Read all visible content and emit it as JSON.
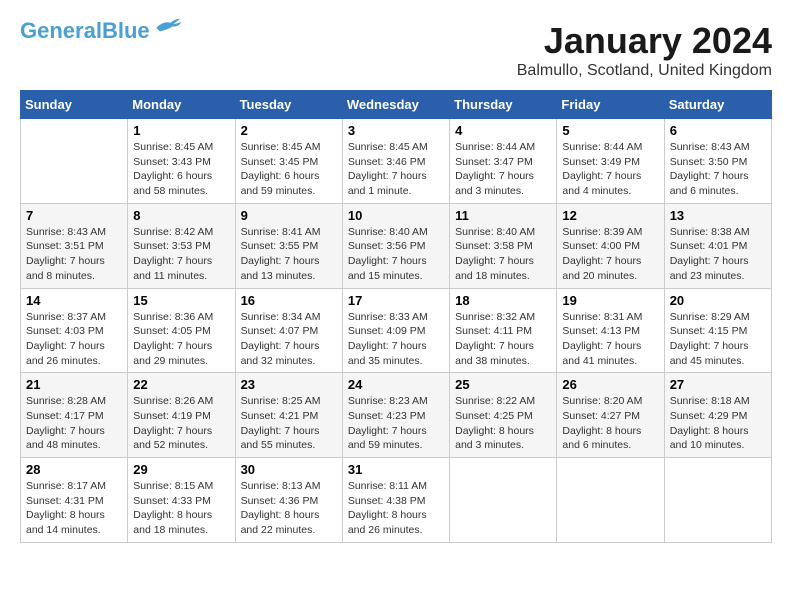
{
  "header": {
    "logo_line1": "General",
    "logo_line2": "Blue",
    "month_title": "January 2024",
    "subtitle": "Balmullo, Scotland, United Kingdom"
  },
  "days_of_week": [
    "Sunday",
    "Monday",
    "Tuesday",
    "Wednesday",
    "Thursday",
    "Friday",
    "Saturday"
  ],
  "weeks": [
    [
      {
        "day": "",
        "info": ""
      },
      {
        "day": "1",
        "info": "Sunrise: 8:45 AM\nSunset: 3:43 PM\nDaylight: 6 hours\nand 58 minutes."
      },
      {
        "day": "2",
        "info": "Sunrise: 8:45 AM\nSunset: 3:45 PM\nDaylight: 6 hours\nand 59 minutes."
      },
      {
        "day": "3",
        "info": "Sunrise: 8:45 AM\nSunset: 3:46 PM\nDaylight: 7 hours\nand 1 minute."
      },
      {
        "day": "4",
        "info": "Sunrise: 8:44 AM\nSunset: 3:47 PM\nDaylight: 7 hours\nand 3 minutes."
      },
      {
        "day": "5",
        "info": "Sunrise: 8:44 AM\nSunset: 3:49 PM\nDaylight: 7 hours\nand 4 minutes."
      },
      {
        "day": "6",
        "info": "Sunrise: 8:43 AM\nSunset: 3:50 PM\nDaylight: 7 hours\nand 6 minutes."
      }
    ],
    [
      {
        "day": "7",
        "info": "Sunrise: 8:43 AM\nSunset: 3:51 PM\nDaylight: 7 hours\nand 8 minutes."
      },
      {
        "day": "8",
        "info": "Sunrise: 8:42 AM\nSunset: 3:53 PM\nDaylight: 7 hours\nand 11 minutes."
      },
      {
        "day": "9",
        "info": "Sunrise: 8:41 AM\nSunset: 3:55 PM\nDaylight: 7 hours\nand 13 minutes."
      },
      {
        "day": "10",
        "info": "Sunrise: 8:40 AM\nSunset: 3:56 PM\nDaylight: 7 hours\nand 15 minutes."
      },
      {
        "day": "11",
        "info": "Sunrise: 8:40 AM\nSunset: 3:58 PM\nDaylight: 7 hours\nand 18 minutes."
      },
      {
        "day": "12",
        "info": "Sunrise: 8:39 AM\nSunset: 4:00 PM\nDaylight: 7 hours\nand 20 minutes."
      },
      {
        "day": "13",
        "info": "Sunrise: 8:38 AM\nSunset: 4:01 PM\nDaylight: 7 hours\nand 23 minutes."
      }
    ],
    [
      {
        "day": "14",
        "info": "Sunrise: 8:37 AM\nSunset: 4:03 PM\nDaylight: 7 hours\nand 26 minutes."
      },
      {
        "day": "15",
        "info": "Sunrise: 8:36 AM\nSunset: 4:05 PM\nDaylight: 7 hours\nand 29 minutes."
      },
      {
        "day": "16",
        "info": "Sunrise: 8:34 AM\nSunset: 4:07 PM\nDaylight: 7 hours\nand 32 minutes."
      },
      {
        "day": "17",
        "info": "Sunrise: 8:33 AM\nSunset: 4:09 PM\nDaylight: 7 hours\nand 35 minutes."
      },
      {
        "day": "18",
        "info": "Sunrise: 8:32 AM\nSunset: 4:11 PM\nDaylight: 7 hours\nand 38 minutes."
      },
      {
        "day": "19",
        "info": "Sunrise: 8:31 AM\nSunset: 4:13 PM\nDaylight: 7 hours\nand 41 minutes."
      },
      {
        "day": "20",
        "info": "Sunrise: 8:29 AM\nSunset: 4:15 PM\nDaylight: 7 hours\nand 45 minutes."
      }
    ],
    [
      {
        "day": "21",
        "info": "Sunrise: 8:28 AM\nSunset: 4:17 PM\nDaylight: 7 hours\nand 48 minutes."
      },
      {
        "day": "22",
        "info": "Sunrise: 8:26 AM\nSunset: 4:19 PM\nDaylight: 7 hours\nand 52 minutes."
      },
      {
        "day": "23",
        "info": "Sunrise: 8:25 AM\nSunset: 4:21 PM\nDaylight: 7 hours\nand 55 minutes."
      },
      {
        "day": "24",
        "info": "Sunrise: 8:23 AM\nSunset: 4:23 PM\nDaylight: 7 hours\nand 59 minutes."
      },
      {
        "day": "25",
        "info": "Sunrise: 8:22 AM\nSunset: 4:25 PM\nDaylight: 8 hours\nand 3 minutes."
      },
      {
        "day": "26",
        "info": "Sunrise: 8:20 AM\nSunset: 4:27 PM\nDaylight: 8 hours\nand 6 minutes."
      },
      {
        "day": "27",
        "info": "Sunrise: 8:18 AM\nSunset: 4:29 PM\nDaylight: 8 hours\nand 10 minutes."
      }
    ],
    [
      {
        "day": "28",
        "info": "Sunrise: 8:17 AM\nSunset: 4:31 PM\nDaylight: 8 hours\nand 14 minutes."
      },
      {
        "day": "29",
        "info": "Sunrise: 8:15 AM\nSunset: 4:33 PM\nDaylight: 8 hours\nand 18 minutes."
      },
      {
        "day": "30",
        "info": "Sunrise: 8:13 AM\nSunset: 4:36 PM\nDaylight: 8 hours\nand 22 minutes."
      },
      {
        "day": "31",
        "info": "Sunrise: 8:11 AM\nSunset: 4:38 PM\nDaylight: 8 hours\nand 26 minutes."
      },
      {
        "day": "",
        "info": ""
      },
      {
        "day": "",
        "info": ""
      },
      {
        "day": "",
        "info": ""
      }
    ]
  ]
}
